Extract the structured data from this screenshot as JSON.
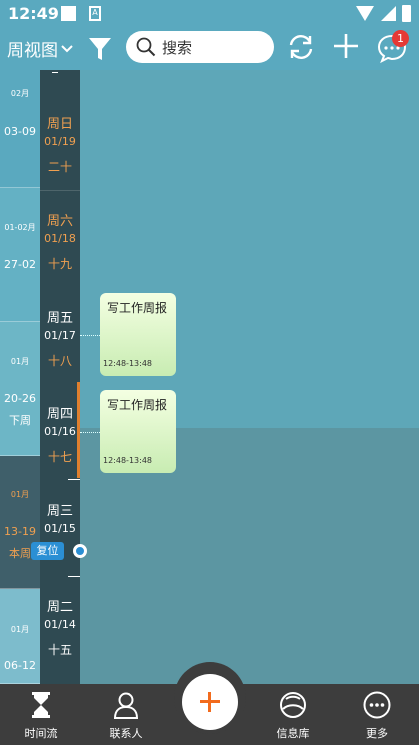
{
  "status_bar": {
    "time": "12:49",
    "notification_icon_letter": "A"
  },
  "toolbar": {
    "view_label": "周视图",
    "search_placeholder": "搜索",
    "message_badge": "1"
  },
  "timeline": {
    "weeks": [
      {
        "month": "02月",
        "range": "03-09",
        "tag": ""
      },
      {
        "month": "01-02月",
        "range": "27-02",
        "tag": ""
      },
      {
        "month": "01月",
        "range": "20-26",
        "tag": "下周"
      },
      {
        "month": "01月",
        "range": "13-19",
        "tag": "本周"
      },
      {
        "month": "01月",
        "range": "06-12",
        "tag": ""
      }
    ],
    "days": [
      {
        "weekday": "周日",
        "date": "01/19",
        "lunar": "二十",
        "color": "#f0a050"
      },
      {
        "weekday": "周六",
        "date": "01/18",
        "lunar": "十九",
        "color": "#f0a050"
      },
      {
        "weekday": "周五",
        "date": "01/17",
        "lunar": "十八",
        "color": "#ffffff"
      },
      {
        "weekday": "周四",
        "date": "01/16",
        "lunar": "十七",
        "color": "#ffffff"
      },
      {
        "weekday": "周三",
        "date": "01/15",
        "lunar": "",
        "color": "#ffffff"
      },
      {
        "weekday": "周二",
        "date": "01/14",
        "lunar": "十五",
        "color": "#ffffff"
      }
    ],
    "events": [
      {
        "title": "写工作周报",
        "time": "12:48-13:48"
      },
      {
        "title": "写工作周报",
        "time": "12:48-13:48"
      }
    ],
    "reset_label": "复位"
  },
  "bottom_nav": {
    "items": [
      "时间流",
      "联系人",
      "信息库",
      "更多"
    ]
  },
  "colors": {
    "accent": "#f26b1d",
    "header": "#5aa9bf",
    "day_column": "#2f4a52",
    "weekend_text": "#f0a050",
    "reset_blue": "#2b8fd4"
  }
}
